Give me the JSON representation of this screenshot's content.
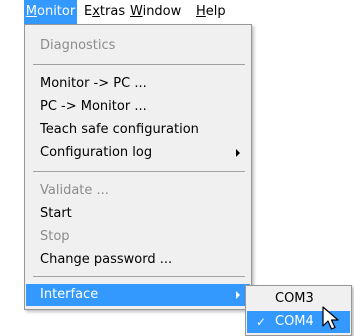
{
  "menubar": {
    "items": [
      {
        "label": "Monitor",
        "mnemonic": "M",
        "rest": "onitor"
      },
      {
        "label": "Extras",
        "pre": "E",
        "mnemonic": "x",
        "rest": "tras"
      },
      {
        "label": "Window",
        "mnemonic": "W",
        "rest": "indow"
      },
      {
        "label": "Help",
        "mnemonic": "H",
        "rest": "elp"
      }
    ]
  },
  "menu": {
    "diagnostics": "Diagnostics",
    "monitor_to_pc": "Monitor -> PC ...",
    "pc_to_monitor": "PC -> Monitor ...",
    "teach_safe_configuration": "Teach safe configuration",
    "configuration_log": "Configuration log",
    "validate": "Validate ...",
    "start": "Start",
    "stop": "Stop",
    "change_password": "Change password ...",
    "interface": "Interface"
  },
  "submenu": {
    "items": [
      "COM3",
      "COM4"
    ],
    "checked": "✓"
  },
  "colors": {
    "highlight": "#3399ff",
    "menu_bg": "#f0f0f0",
    "disabled_text": "#8c8c8c"
  }
}
